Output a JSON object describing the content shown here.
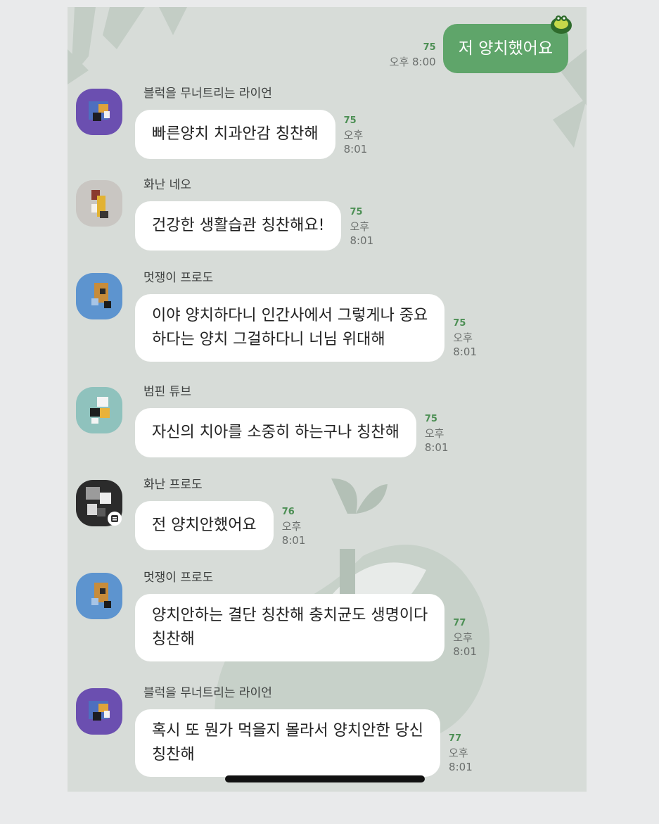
{
  "sent_message": {
    "text": "저 양치했어요",
    "read_count": "75",
    "time": "오후 8:00"
  },
  "messages": [
    {
      "sender": "블럭을 무너트리는 라이언",
      "lines": [
        "빠른양치 치과안감 칭찬해"
      ],
      "read_count": "75",
      "time": "오후 8:01"
    },
    {
      "sender": "화난 네오",
      "lines": [
        "건강한 생활습관 칭찬해요!"
      ],
      "read_count": "75",
      "time": "오후 8:01"
    },
    {
      "sender": "멋쟁이 프로도",
      "lines": [
        "이야 양치하다니 인간사에서 그렇게나 중요",
        "하다는 양치 그걸하다니 너님 위대해"
      ],
      "read_count": "75",
      "time": "오후 8:01"
    },
    {
      "sender": "범핀 튜브",
      "lines": [
        "자신의 치아를 소중히 하는구나 칭찬해"
      ],
      "read_count": "75",
      "time": "오후 8:01"
    },
    {
      "sender": "화난 프로도",
      "lines": [
        "전 양치안했어요"
      ],
      "read_count": "76",
      "time": "오후 8:01"
    },
    {
      "sender": "멋쟁이 프로도",
      "lines": [
        "양치안하는 결단 칭찬해 충치균도 생명이다",
        "칭찬해"
      ],
      "read_count": "77",
      "time": "오후 8:01"
    },
    {
      "sender": "블럭을 무너트리는 라이언",
      "lines": [
        "혹시 또 뭔가 먹을지 몰라서 양치안한 당신",
        "칭찬해"
      ],
      "read_count": "77",
      "time": "오후 8:01"
    }
  ],
  "theme": {
    "background": "#d7dcd8",
    "sent_bubble": "#5fa56a",
    "received_bubble": "#ffffff",
    "read_count_color": "#4c8f54"
  },
  "icons": {
    "sent_sticker": "turtle-sticker-icon",
    "avatar_badge": "chat-badge-icon"
  }
}
